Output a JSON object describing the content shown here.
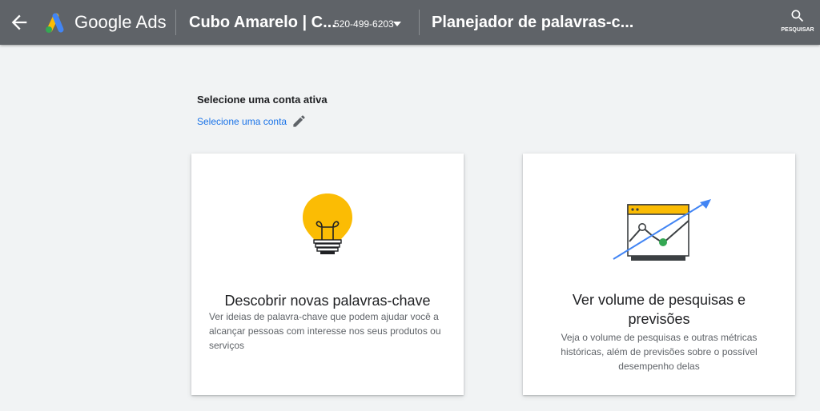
{
  "header": {
    "product_name": "Google Ads",
    "account_name": "Cubo Amarelo | C...",
    "account_id": "520-499-6203",
    "page_title": "Planejador de palavras-c...",
    "search_label": "PESQUISAR",
    "icons": {
      "back": "arrow-left-icon",
      "logo": "google-ads-logo",
      "caret": "caret-down-icon",
      "search": "search-icon"
    },
    "colors": {
      "bar": "#5f6368",
      "logo_blue": "#4285f4",
      "logo_yellow": "#fbbc04",
      "logo_green": "#34a853"
    }
  },
  "account_section": {
    "heading": "Selecione uma conta ativa",
    "link_text": "Selecione uma conta",
    "link_icon": "pencil-icon",
    "link_color": "#1a73e8"
  },
  "cards": [
    {
      "title": "Descobrir novas palavras-chave",
      "description": "Ver ideias de palavra-chave que podem ajudar você a alcançar pessoas com interesse nos seus produtos ou serviços",
      "icon": "lightbulb-icon"
    },
    {
      "title": "Ver volume de pesquisas e previsões",
      "description": "Veja o volume de pesquisas e outras métricas históricas, além de previsões sobre o possível desempenho delas",
      "icon": "trend-chart-icon"
    }
  ]
}
